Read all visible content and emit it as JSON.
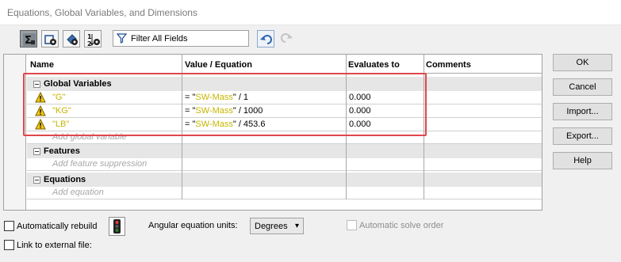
{
  "window": {
    "title": "Equations, Global Variables, and Dimensions"
  },
  "toolbar": {
    "buttons": [
      {
        "name": "equation-view-icon",
        "active": true
      },
      {
        "name": "sketch-equation-view-icon",
        "active": false
      },
      {
        "name": "dimension-view-icon",
        "active": false
      },
      {
        "name": "ordered-view-icon",
        "active": false
      }
    ],
    "filter_placeholder": "Filter All Fields",
    "undo_icon": "undo-icon",
    "redo_icon": "redo-icon"
  },
  "table": {
    "headers": {
      "name": "Name",
      "value": "Value / Equation",
      "evaluates": "Evaluates to",
      "comments": "Comments"
    },
    "groups": {
      "global_variables": {
        "label": "Global Variables",
        "rows": [
          {
            "name_prefix": "\"",
            "name": "G",
            "name_suffix": "\"",
            "eq_prefix": "= \"",
            "eq_var": "SW-Mass",
            "eq_suffix": "\" / 1",
            "evaluates": "0.000"
          },
          {
            "name_prefix": "\"",
            "name": "KG",
            "name_suffix": "\"",
            "eq_prefix": "= \"",
            "eq_var": "SW-Mass",
            "eq_suffix": "\" / 1000",
            "evaluates": "0.000"
          },
          {
            "name_prefix": "\"",
            "name": "LB",
            "name_suffix": "\"",
            "eq_prefix": "= \"",
            "eq_var": "SW-Mass",
            "eq_suffix": "\" / 453.6",
            "evaluates": "0.000"
          }
        ],
        "add_placeholder": "Add global variable"
      },
      "features": {
        "label": "Features",
        "add_placeholder": "Add feature suppression"
      },
      "equations": {
        "label": "Equations",
        "add_placeholder": "Add equation"
      }
    }
  },
  "buttons": {
    "ok": "OK",
    "cancel": "Cancel",
    "import": "Import...",
    "export": "Export...",
    "help": "Help"
  },
  "footer": {
    "auto_rebuild_label": "Automatically rebuild",
    "angular_units_label": "Angular equation units:",
    "angular_units_value": "Degrees",
    "auto_solve_label": "Automatic solve order",
    "link_external_label": "Link to external file:"
  },
  "colors": {
    "highlight_border": "#e0474c",
    "variable_text": "#c6b600",
    "warning": "#f2c811"
  }
}
